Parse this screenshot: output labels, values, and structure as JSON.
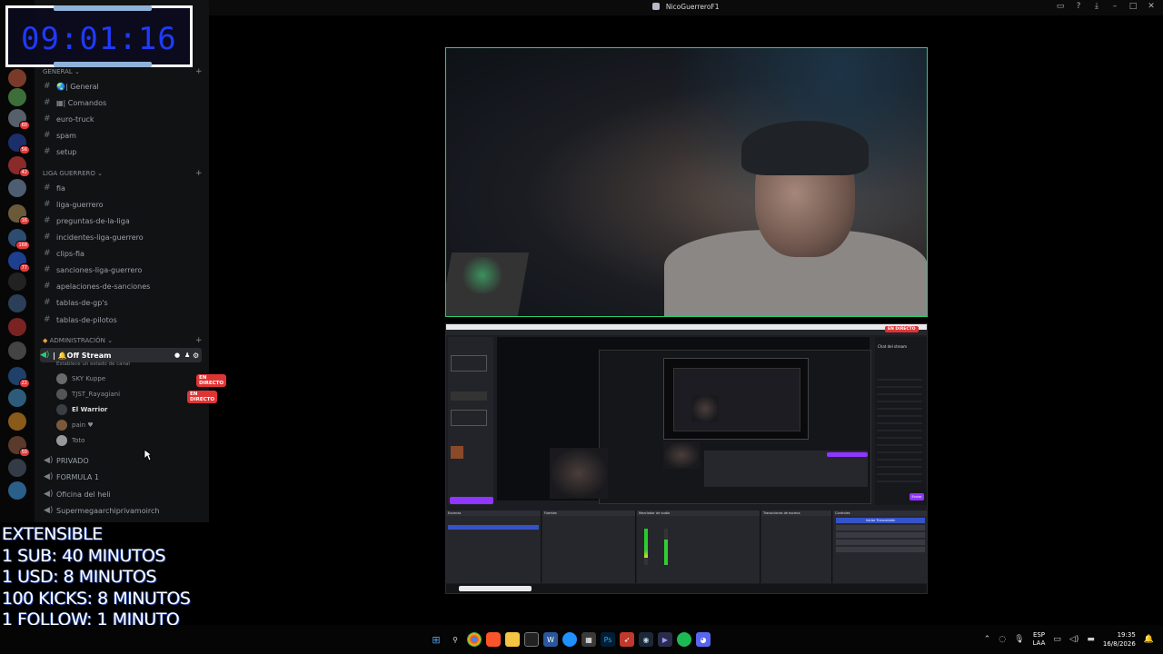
{
  "window": {
    "title": "NicoGuerreroF1",
    "controls": [
      "inbox-icon",
      "help-icon",
      "download-icon",
      "minimize-icon",
      "maximize-icon",
      "close-icon"
    ]
  },
  "timer": {
    "value": "09:01:16"
  },
  "server_badges": [
    "60",
    "56",
    "42",
    "16",
    "168",
    "77",
    "22",
    "50"
  ],
  "channels": {
    "general_category": "GENERAL",
    "general_channels": [
      "🌏| General",
      "▦| Comandos",
      "euro-truck",
      "spam",
      "setup"
    ],
    "liga_category": "LIGA GUERRERO",
    "liga_channels": [
      "fia",
      "liga-guerrero",
      "preguntas-de-la-liga",
      "incidentes-liga-guerrero",
      "clips-fia",
      "sanciones-liga-guerrero",
      "apelaciones-de-sanciones",
      "tablas-de-gp's",
      "tablas-de-pilotos"
    ],
    "admin_category": "ADMINISTRACIÓN",
    "active_voice": "| 🔔Off Stream",
    "status_prompt": "Establece un estado de canal",
    "voice_users": [
      {
        "name": "SKY Kuppe",
        "live": "EN DIRECTO"
      },
      {
        "name": "TJST_Rayagiani",
        "live": "EN DIRECTO"
      },
      {
        "name": "El Warrior",
        "live": ""
      },
      {
        "name": "pain ♥",
        "live": ""
      },
      {
        "name": "Toto",
        "live": ""
      }
    ],
    "other_voice": [
      "PRIVADO",
      "FORMULA 1",
      "Oficina del heli",
      "Supermegaarchiprivamoirch"
    ]
  },
  "overlay": {
    "lines": [
      "EXTENSIBLE",
      "1 SUB: 40 MINUTOS",
      "1 USD: 8 MINUTOS",
      "100 KICKS: 8 MINUTOS",
      "1 FOLLOW: 1 MINUTO"
    ]
  },
  "stream": {
    "live_badge": "EN DIRECTO",
    "chat_title": "Chat del stream",
    "button_start": "Iniciar Transmisión",
    "button_chat": "Enviar"
  },
  "taskbar": {
    "apps": [
      "start-icon",
      "search-icon",
      "chrome-icon",
      "brave-icon",
      "files-icon",
      "obs-icon",
      "word-icon",
      "edge-icon",
      "calculator-icon",
      "photoshop-icon",
      "arrow-icon",
      "steam-icon",
      "premiere-icon",
      "spotify-icon",
      "discord-icon"
    ],
    "lang": "ESP",
    "lang_sub": "LAA",
    "time": "19:35",
    "date": "16/8/2026"
  },
  "colors": {
    "accent_live": "#e03434",
    "timer_digits": "#1f3aff",
    "webcam_border": "#2ecc71",
    "obs_purple": "#8f36ff"
  }
}
